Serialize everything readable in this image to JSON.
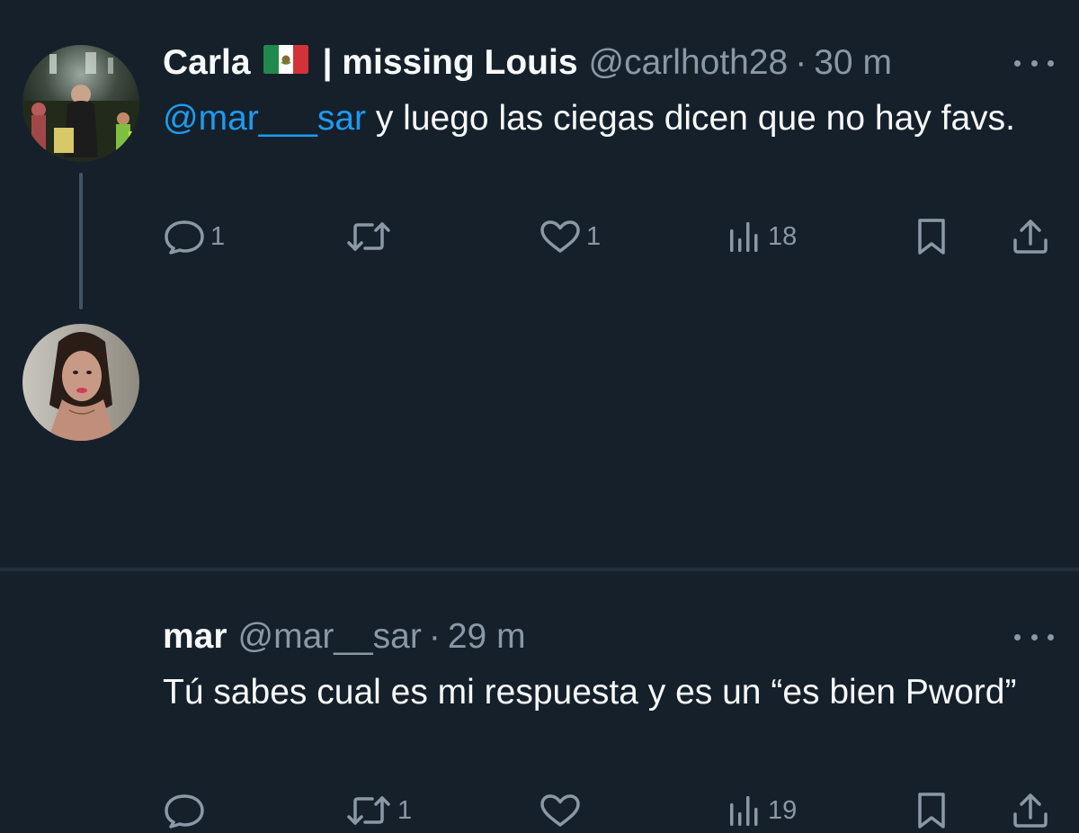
{
  "tweets": [
    {
      "display_name": "Carla",
      "flag": "mexico-flag",
      "name_suffix": "| missing Louis",
      "handle": "@carlhoth28",
      "separator": "·",
      "time": "30 m",
      "mention": "@mar___sar",
      "body": " y luego las ciegas dicen que no hay favs.",
      "metrics": {
        "replies": "1",
        "retweets": "",
        "likes": "1",
        "views": "18"
      }
    },
    {
      "display_name": "mar",
      "handle": "@mar__sar",
      "separator": "·",
      "time": "29 m",
      "body": "Tú sabes cual es mi respuesta y es un “es bien Pword”",
      "metrics": {
        "replies": "",
        "retweets": "1",
        "likes": "",
        "views": "19"
      }
    }
  ],
  "icons": [
    "reply-icon",
    "retweet-icon",
    "like-icon",
    "views-icon",
    "bookmark-icon",
    "share-icon",
    "more-icon"
  ],
  "colors": {
    "background": "#15202b",
    "text": "#f7f9f9",
    "secondary": "#8b98a5",
    "mention": "#1d9bf0",
    "thread_line": "#425364"
  }
}
